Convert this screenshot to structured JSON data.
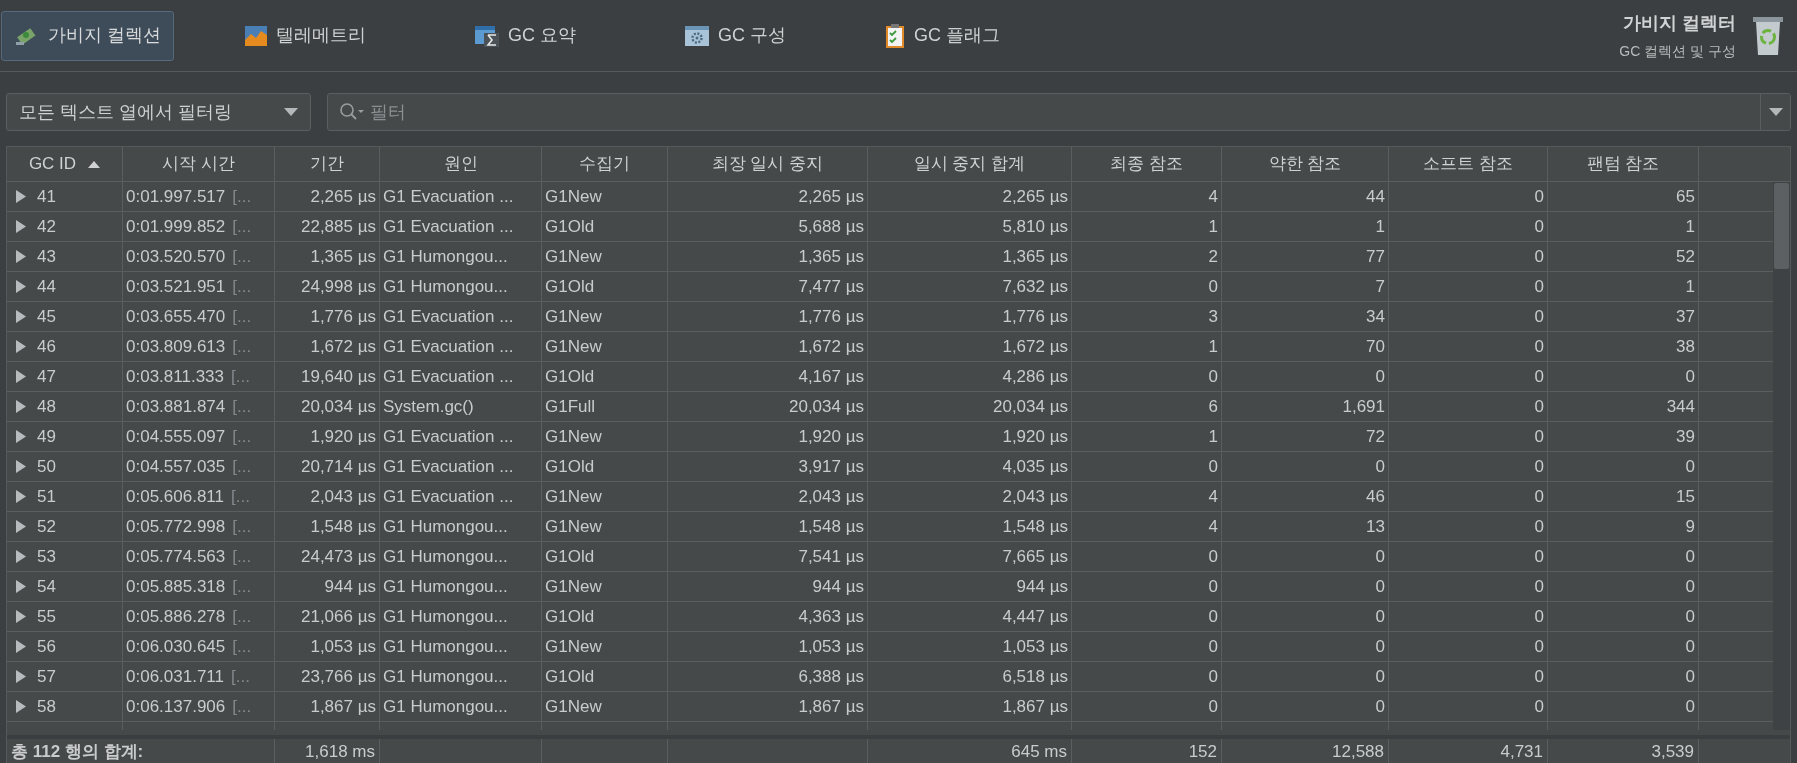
{
  "tabs": [
    {
      "label": "가비지 컬렉션",
      "selected": true
    },
    {
      "label": "텔레메트리",
      "selected": false
    },
    {
      "label": "GC 요약",
      "selected": false
    },
    {
      "label": "GC 구성",
      "selected": false
    },
    {
      "label": "GC 플래그",
      "selected": false
    }
  ],
  "header": {
    "title": "가비지 컬렉터",
    "subtitle": "GC 컬렉션 및 구성"
  },
  "filter": {
    "scope": "모든 텍스트 열에서 필터링",
    "placeholder": "필터"
  },
  "table": {
    "columns": [
      {
        "label": "GC ID",
        "sorted": true
      },
      {
        "label": "시작 시간",
        "sorted": false
      },
      {
        "label": "기간",
        "sorted": false
      },
      {
        "label": "원인",
        "sorted": false
      },
      {
        "label": "수집기",
        "sorted": false
      },
      {
        "label": "최장 일시 중지",
        "sorted": false
      },
      {
        "label": "일시 중지 합계",
        "sorted": false
      },
      {
        "label": "최종 참조",
        "sorted": false
      },
      {
        "label": "약한 참조",
        "sorted": false
      },
      {
        "label": "소프트 참조",
        "sorted": false
      },
      {
        "label": "팬텀 참조",
        "sorted": false
      }
    ],
    "rows": [
      {
        "expanded": false,
        "more": "[...",
        "cells": [
          "41",
          "0:01.997.517",
          "2,265 µs",
          "G1 Evacuation ...",
          "G1New",
          "2,265 µs",
          "2,265 µs",
          "4",
          "44",
          "0",
          "65"
        ]
      },
      {
        "expanded": false,
        "more": "[...",
        "cells": [
          "42",
          "0:01.999.852",
          "22,885 µs",
          "G1 Evacuation ...",
          "G1Old",
          "5,688 µs",
          "5,810 µs",
          "1",
          "1",
          "0",
          "1"
        ]
      },
      {
        "expanded": false,
        "more": "[...",
        "cells": [
          "43",
          "0:03.520.570",
          "1,365 µs",
          "G1 Humongou...",
          "G1New",
          "1,365 µs",
          "1,365 µs",
          "2",
          "77",
          "0",
          "52"
        ]
      },
      {
        "expanded": false,
        "more": "[...",
        "cells": [
          "44",
          "0:03.521.951",
          "24,998 µs",
          "G1 Humongou...",
          "G1Old",
          "7,477 µs",
          "7,632 µs",
          "0",
          "7",
          "0",
          "1"
        ]
      },
      {
        "expanded": false,
        "more": "[...",
        "cells": [
          "45",
          "0:03.655.470",
          "1,776 µs",
          "G1 Evacuation ...",
          "G1New",
          "1,776 µs",
          "1,776 µs",
          "3",
          "34",
          "0",
          "37"
        ]
      },
      {
        "expanded": false,
        "more": "[...",
        "cells": [
          "46",
          "0:03.809.613",
          "1,672 µs",
          "G1 Evacuation ...",
          "G1New",
          "1,672 µs",
          "1,672 µs",
          "1",
          "70",
          "0",
          "38"
        ]
      },
      {
        "expanded": false,
        "more": "[...",
        "cells": [
          "47",
          "0:03.811.333",
          "19,640 µs",
          "G1 Evacuation ...",
          "G1Old",
          "4,167 µs",
          "4,286 µs",
          "0",
          "0",
          "0",
          "0"
        ]
      },
      {
        "expanded": false,
        "more": "[...",
        "cells": [
          "48",
          "0:03.881.874",
          "20,034 µs",
          "System.gc()",
          "G1Full",
          "20,034 µs",
          "20,034 µs",
          "6",
          "1,691",
          "0",
          "344"
        ]
      },
      {
        "expanded": false,
        "more": "[...",
        "cells": [
          "49",
          "0:04.555.097",
          "1,920 µs",
          "G1 Evacuation ...",
          "G1New",
          "1,920 µs",
          "1,920 µs",
          "1",
          "72",
          "0",
          "39"
        ]
      },
      {
        "expanded": false,
        "more": "[...",
        "cells": [
          "50",
          "0:04.557.035",
          "20,714 µs",
          "G1 Evacuation ...",
          "G1Old",
          "3,917 µs",
          "4,035 µs",
          "0",
          "0",
          "0",
          "0"
        ]
      },
      {
        "expanded": false,
        "more": "[...",
        "cells": [
          "51",
          "0:05.606.811",
          "2,043 µs",
          "G1 Evacuation ...",
          "G1New",
          "2,043 µs",
          "2,043 µs",
          "4",
          "46",
          "0",
          "15"
        ]
      },
      {
        "expanded": false,
        "more": "[...",
        "cells": [
          "52",
          "0:05.772.998",
          "1,548 µs",
          "G1 Humongou...",
          "G1New",
          "1,548 µs",
          "1,548 µs",
          "4",
          "13",
          "0",
          "9"
        ]
      },
      {
        "expanded": false,
        "more": "[...",
        "cells": [
          "53",
          "0:05.774.563",
          "24,473 µs",
          "G1 Humongou...",
          "G1Old",
          "7,541 µs",
          "7,665 µs",
          "0",
          "0",
          "0",
          "0"
        ]
      },
      {
        "expanded": false,
        "more": "[...",
        "cells": [
          "54",
          "0:05.885.318",
          "944 µs",
          "G1 Humongou...",
          "G1New",
          "944 µs",
          "944 µs",
          "0",
          "0",
          "0",
          "0"
        ]
      },
      {
        "expanded": false,
        "more": "[...",
        "cells": [
          "55",
          "0:05.886.278",
          "21,066 µs",
          "G1 Humongou...",
          "G1Old",
          "4,363 µs",
          "4,447 µs",
          "0",
          "0",
          "0",
          "0"
        ]
      },
      {
        "expanded": false,
        "more": "[...",
        "cells": [
          "56",
          "0:06.030.645",
          "1,053 µs",
          "G1 Humongou...",
          "G1New",
          "1,053 µs",
          "1,053 µs",
          "0",
          "0",
          "0",
          "0"
        ]
      },
      {
        "expanded": false,
        "more": "[...",
        "cells": [
          "57",
          "0:06.031.711",
          "23,766 µs",
          "G1 Humongou...",
          "G1Old",
          "6,388 µs",
          "6,518 µs",
          "0",
          "0",
          "0",
          "0"
        ]
      },
      {
        "expanded": false,
        "more": "[...",
        "cells": [
          "58",
          "0:06.137.906",
          "1,867 µs",
          "G1 Humongou...",
          "G1New",
          "1,867 µs",
          "1,867 µs",
          "0",
          "0",
          "0",
          "0"
        ]
      }
    ],
    "totals": {
      "label": "총 112 행의 합계:",
      "duration": "1,618 ms",
      "total_pause": "645 ms",
      "final": "152",
      "weak": "12,588",
      "soft": "4,731",
      "phantom": "3,539"
    }
  }
}
